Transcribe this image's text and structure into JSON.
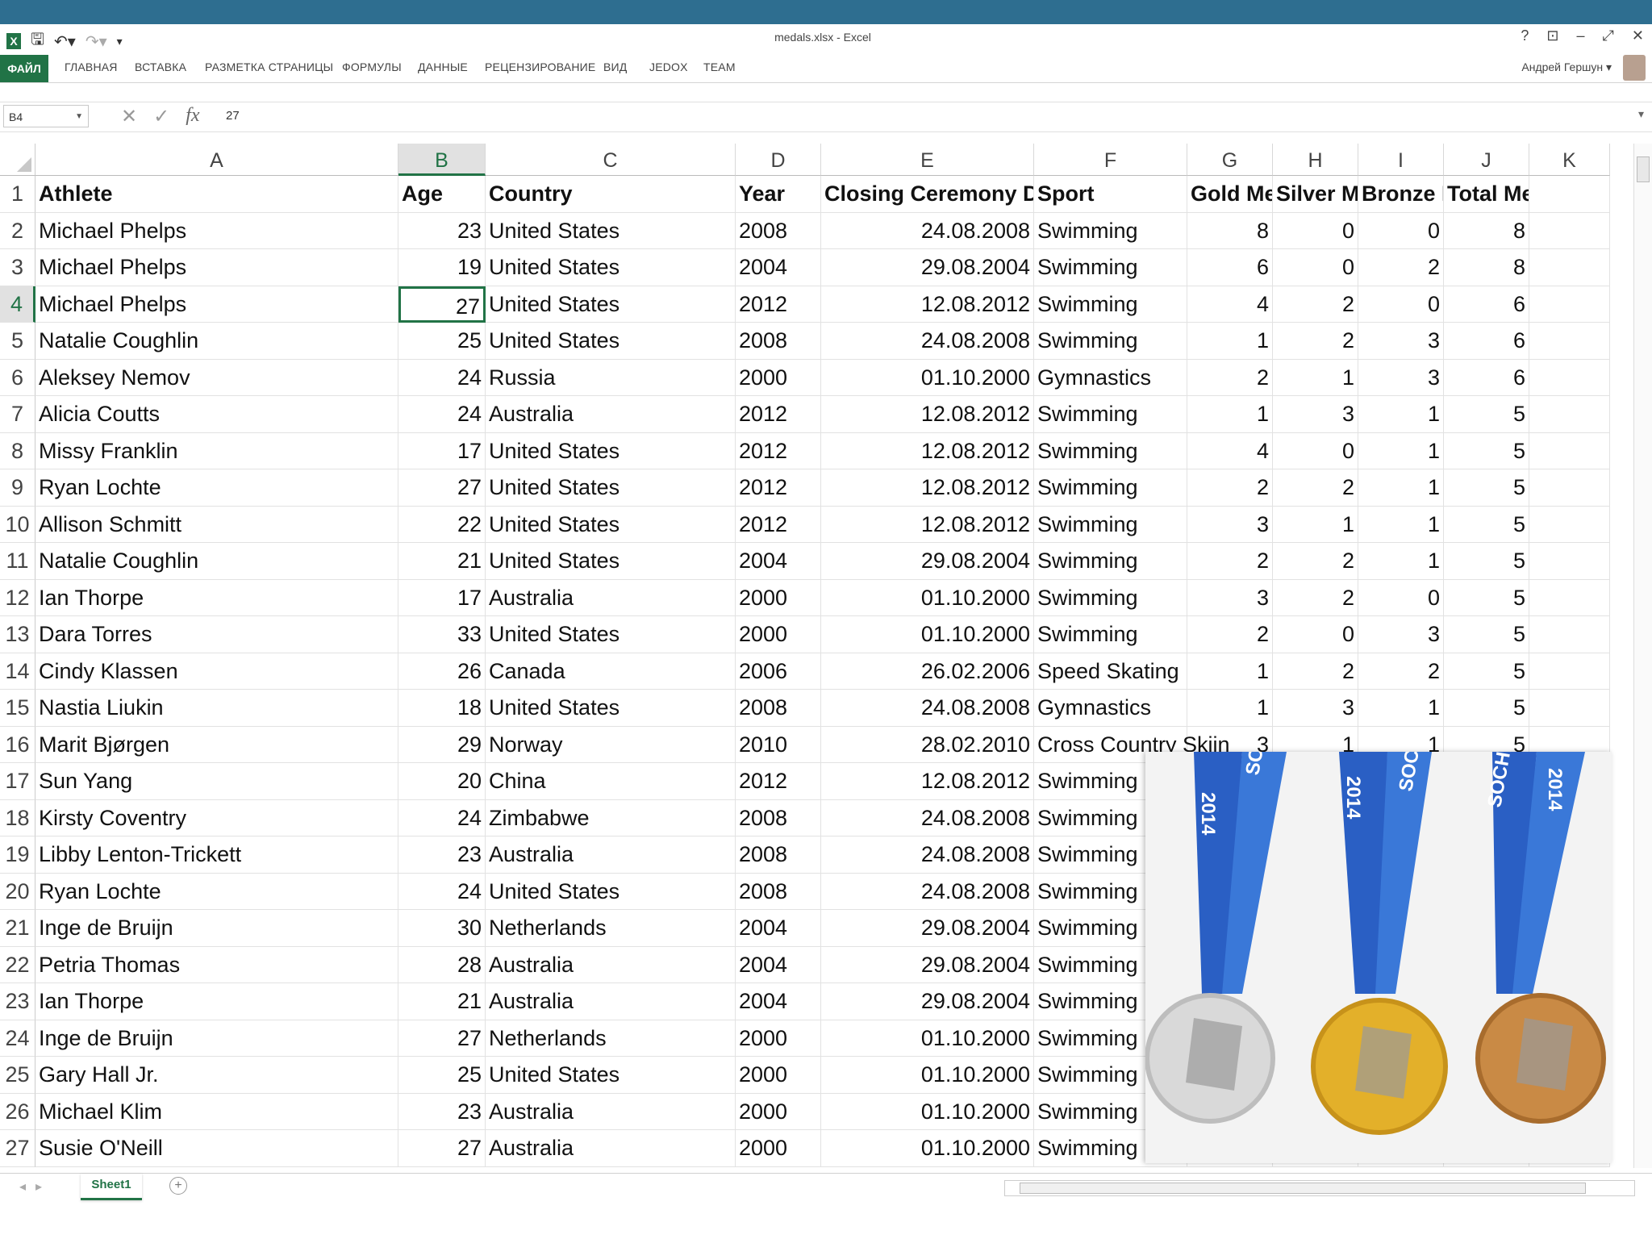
{
  "window": {
    "title": "medals.xlsx - Excel",
    "controls": [
      "?",
      "⊡",
      "–",
      "⤢",
      "✕"
    ]
  },
  "quick_access": [
    "save-icon",
    "undo-icon",
    "redo-icon",
    "customize-icon"
  ],
  "ribbon": {
    "file_tab": "ФАЙЛ",
    "tabs": [
      "ГЛАВНАЯ",
      "ВСТАВКА",
      "РАЗМЕТКА СТРАНИЦЫ",
      "ФОРМУЛЫ",
      "ДАННЫЕ",
      "РЕЦЕНЗИРОВАНИЕ",
      "ВИД",
      "JEDOX",
      "TEAM"
    ],
    "user": "Андрей Гершун ▾"
  },
  "formula_bar": {
    "name_box": "B4",
    "value": "27"
  },
  "columns": [
    "A",
    "B",
    "C",
    "D",
    "E",
    "F",
    "G",
    "H",
    "I",
    "J",
    "K"
  ],
  "selected_column": "B",
  "selected_row": 4,
  "header_row": [
    "Athlete",
    "Age",
    "Country",
    "Year",
    "Closing Ceremony Date",
    "Sport",
    "Gold Med",
    "Silver Me",
    "Bronze M",
    "Total Medals"
  ],
  "rows": [
    [
      "Michael Phelps",
      "23",
      "United States",
      "2008",
      "24.08.2008",
      "Swimming",
      "8",
      "0",
      "0",
      "8"
    ],
    [
      "Michael Phelps",
      "19",
      "United States",
      "2004",
      "29.08.2004",
      "Swimming",
      "6",
      "0",
      "2",
      "8"
    ],
    [
      "Michael Phelps",
      "27",
      "United States",
      "2012",
      "12.08.2012",
      "Swimming",
      "4",
      "2",
      "0",
      "6"
    ],
    [
      "Natalie Coughlin",
      "25",
      "United States",
      "2008",
      "24.08.2008",
      "Swimming",
      "1",
      "2",
      "3",
      "6"
    ],
    [
      "Aleksey Nemov",
      "24",
      "Russia",
      "2000",
      "01.10.2000",
      "Gymnastics",
      "2",
      "1",
      "3",
      "6"
    ],
    [
      "Alicia Coutts",
      "24",
      "Australia",
      "2012",
      "12.08.2012",
      "Swimming",
      "1",
      "3",
      "1",
      "5"
    ],
    [
      "Missy Franklin",
      "17",
      "United States",
      "2012",
      "12.08.2012",
      "Swimming",
      "4",
      "0",
      "1",
      "5"
    ],
    [
      "Ryan Lochte",
      "27",
      "United States",
      "2012",
      "12.08.2012",
      "Swimming",
      "2",
      "2",
      "1",
      "5"
    ],
    [
      "Allison Schmitt",
      "22",
      "United States",
      "2012",
      "12.08.2012",
      "Swimming",
      "3",
      "1",
      "1",
      "5"
    ],
    [
      "Natalie Coughlin",
      "21",
      "United States",
      "2004",
      "29.08.2004",
      "Swimming",
      "2",
      "2",
      "1",
      "5"
    ],
    [
      "Ian Thorpe",
      "17",
      "Australia",
      "2000",
      "01.10.2000",
      "Swimming",
      "3",
      "2",
      "0",
      "5"
    ],
    [
      "Dara Torres",
      "33",
      "United States",
      "2000",
      "01.10.2000",
      "Swimming",
      "2",
      "0",
      "3",
      "5"
    ],
    [
      "Cindy Klassen",
      "26",
      "Canada",
      "2006",
      "26.02.2006",
      "Speed Skating",
      "1",
      "2",
      "2",
      "5"
    ],
    [
      "Nastia Liukin",
      "18",
      "United States",
      "2008",
      "24.08.2008",
      "Gymnastics",
      "1",
      "3",
      "1",
      "5"
    ],
    [
      "Marit Bjørgen",
      "29",
      "Norway",
      "2010",
      "28.02.2010",
      "Cross Country Skiin",
      "3",
      "1",
      "1",
      "5"
    ],
    [
      "Sun Yang",
      "20",
      "China",
      "2012",
      "12.08.2012",
      "Swimming",
      "",
      "",
      "",
      ""
    ],
    [
      "Kirsty Coventry",
      "24",
      "Zimbabwe",
      "2008",
      "24.08.2008",
      "Swimming",
      "",
      "",
      "",
      ""
    ],
    [
      "Libby Lenton-Trickett",
      "23",
      "Australia",
      "2008",
      "24.08.2008",
      "Swimming",
      "",
      "",
      "",
      ""
    ],
    [
      "Ryan Lochte",
      "24",
      "United States",
      "2008",
      "24.08.2008",
      "Swimming",
      "",
      "",
      "",
      ""
    ],
    [
      "Inge de Bruijn",
      "30",
      "Netherlands",
      "2004",
      "29.08.2004",
      "Swimming",
      "",
      "",
      "",
      ""
    ],
    [
      "Petria Thomas",
      "28",
      "Australia",
      "2004",
      "29.08.2004",
      "Swimming",
      "",
      "",
      "",
      ""
    ],
    [
      "Ian Thorpe",
      "21",
      "Australia",
      "2004",
      "29.08.2004",
      "Swimming",
      "",
      "",
      "",
      ""
    ],
    [
      "Inge de Bruijn",
      "27",
      "Netherlands",
      "2000",
      "01.10.2000",
      "Swimming",
      "",
      "",
      "",
      ""
    ],
    [
      "Gary Hall Jr.",
      "25",
      "United States",
      "2000",
      "01.10.2000",
      "Swimming",
      "",
      "",
      "",
      ""
    ],
    [
      "Michael Klim",
      "23",
      "Australia",
      "2000",
      "01.10.2000",
      "Swimming",
      "",
      "",
      "",
      ""
    ],
    [
      "Susie O'Neill",
      "27",
      "Australia",
      "2000",
      "01.10.2000",
      "Swimming",
      "",
      "",
      "",
      ""
    ]
  ],
  "photo": {
    "ribbon_text_1": "SOCHI",
    "ribbon_text_2": "2014",
    "medals": [
      "silver",
      "gold",
      "bronze"
    ],
    "colors": {
      "ribbon": "#2a5fc4",
      "silver": "#d9d9d9",
      "gold": "#e3b02a",
      "bronze": "#c98a45"
    }
  },
  "sheet_tabs": [
    "Sheet1"
  ],
  "accent_color": "#217346"
}
